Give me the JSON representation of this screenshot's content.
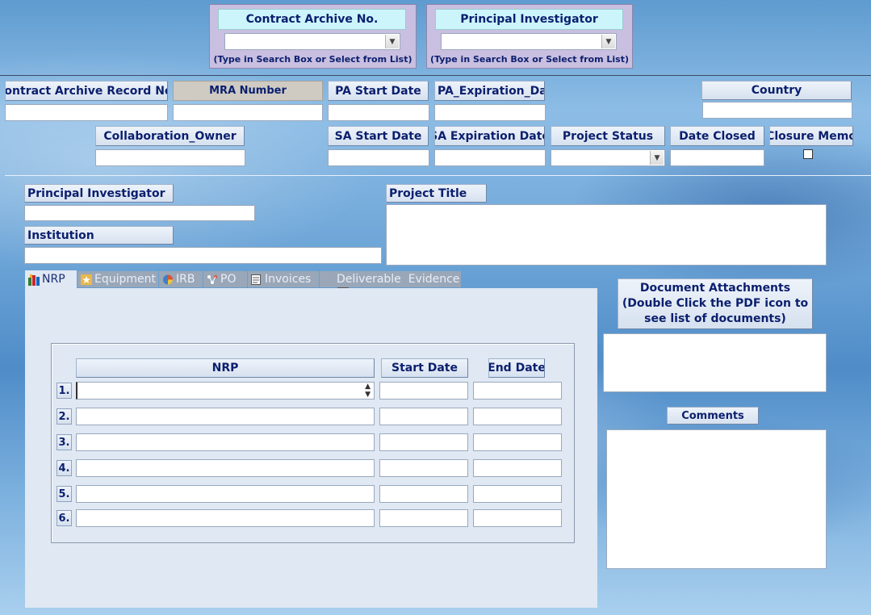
{
  "search": {
    "contract_label": "Contract Archive No.",
    "contract_hint": "(Type in Search Box or Select from List)",
    "pi_label": "Principal Investigator",
    "pi_hint": "(Type in Search Box or Select from List)"
  },
  "record": {
    "contract_record_label": "Contract Archive Record No.",
    "mra_label": "MRA Number",
    "pa_start_label": "PA Start Date",
    "pa_exp_label": "PA_Expiration_Date",
    "country_label": "Country",
    "collab_owner_label": "Collaboration_Owner",
    "sa_start_label": "SA Start Date",
    "sa_exp_label": "SA Expiration Date",
    "project_status_label": "Project Status",
    "date_closed_label": "Date Closed",
    "closure_memo_label": "Closure Memo",
    "pi_label": "Principal Investigator",
    "institution_label": "Institution",
    "project_title_label": "Project Title"
  },
  "tabs": [
    {
      "label": "NRP",
      "icon": "nrp-icon"
    },
    {
      "label": "Equipment",
      "icon": "star-icon"
    },
    {
      "label": "IRB",
      "icon": "pie-icon"
    },
    {
      "label": "PO",
      "icon": "network-icon"
    },
    {
      "label": "Invoices",
      "icon": "page-icon"
    },
    {
      "label": "Deliverable  Evidence",
      "icon": "table-icon"
    }
  ],
  "nrp_table": {
    "col_nrp": "NRP",
    "col_start": "Start Date",
    "col_end": "End Date",
    "rows": [
      "1.",
      "2.",
      "3.",
      "4.",
      "5.",
      "6."
    ]
  },
  "attachments": {
    "label": "Document Attachments (Double Click the PDF icon to see list of documents)",
    "line1": "Document Attachments",
    "line2": "(Double Click the PDF icon to",
    "line3": "see list of documents)"
  },
  "comments": {
    "label": "Comments"
  },
  "colors": {
    "label_text": "#0b1f6e",
    "search_label_bg": "#ccf5fb",
    "search_panel_bg": "#c9bfe0",
    "mra_bg": "#cfcbc3",
    "tab_panel_bg": "#dfe8f3"
  }
}
